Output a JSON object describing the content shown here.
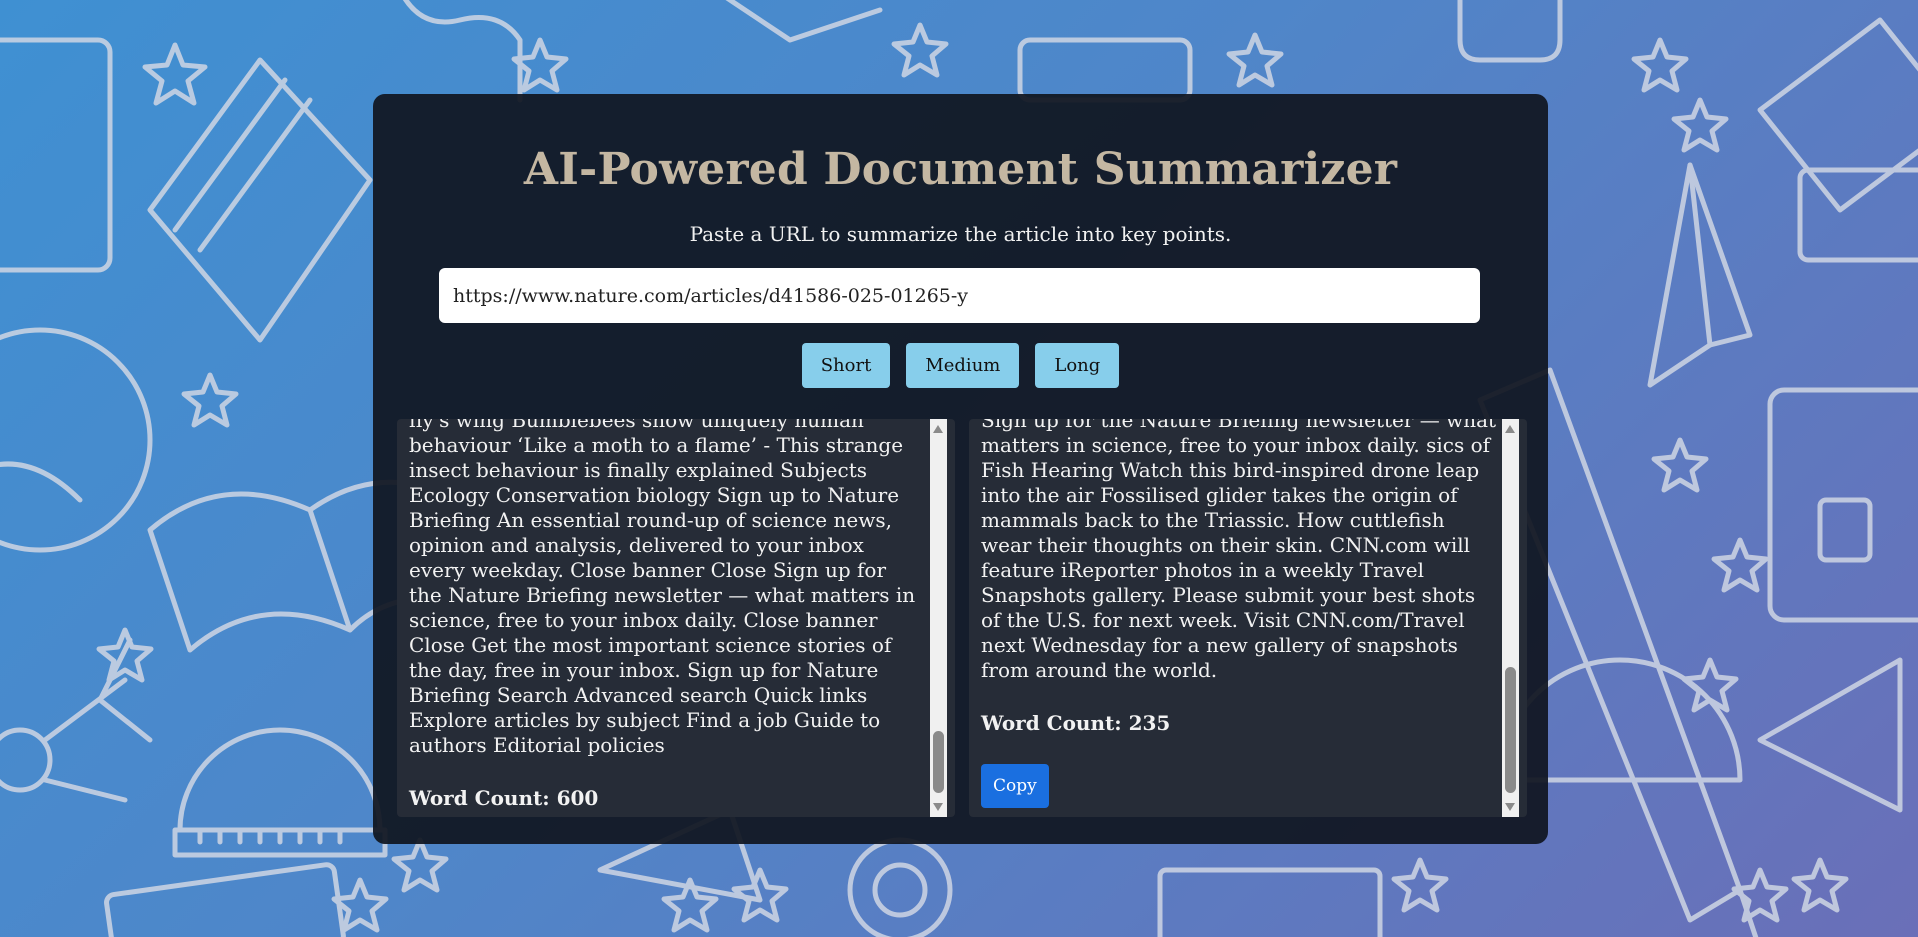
{
  "app": {
    "title": "AI-Powered Document Summarizer",
    "subtitle": "Paste a URL to summarize the article into key points."
  },
  "url_input": {
    "value": "https://www.nature.com/articles/d41586-025-01265-y"
  },
  "length_buttons": {
    "short": "Short",
    "medium": "Medium",
    "long": "Long"
  },
  "original_panel": {
    "text": "fly's wing Bumblebees show uniquely human behaviour ‘Like a moth to a flame’ - This strange insect behaviour is finally explained Subjects Ecology Conservation biology Sign up to Nature Briefing An essential round-up of science news, opinion and analysis, delivered to your inbox every weekday. Close banner Close Sign up for the Nature Briefing newsletter — what matters in science, free to your inbox daily. Close banner Close Get the most important science stories of the day, free in your inbox. Sign up for Nature Briefing Search Advanced search Quick links Explore articles by subject Find a job Guide to authors Editorial policies",
    "word_count": "Word Count: 600"
  },
  "summary_panel": {
    "text": "Sign up for the Nature Briefing newsletter — what matters in science, free to your inbox daily. sics of Fish Hearing Watch this bird-inspired drone leap into the air Fossilised glider takes the origin of mammals back to the Triassic. How cuttlefish wear their thoughts on their skin. CNN.com will feature iReporter photos in a weekly Travel Snapshots gallery. Please submit your best shots of the U.S. for next week. Visit CNN.com/Travel next Wednesday for a new gallery of snapshots from around the world.",
    "word_count": "Word Count: 235",
    "copy_label": "Copy"
  },
  "colors": {
    "title": "#c4b7a2",
    "length_button": "#87ceeb",
    "copy_button": "#1a6fe0",
    "card": "#10161f"
  }
}
